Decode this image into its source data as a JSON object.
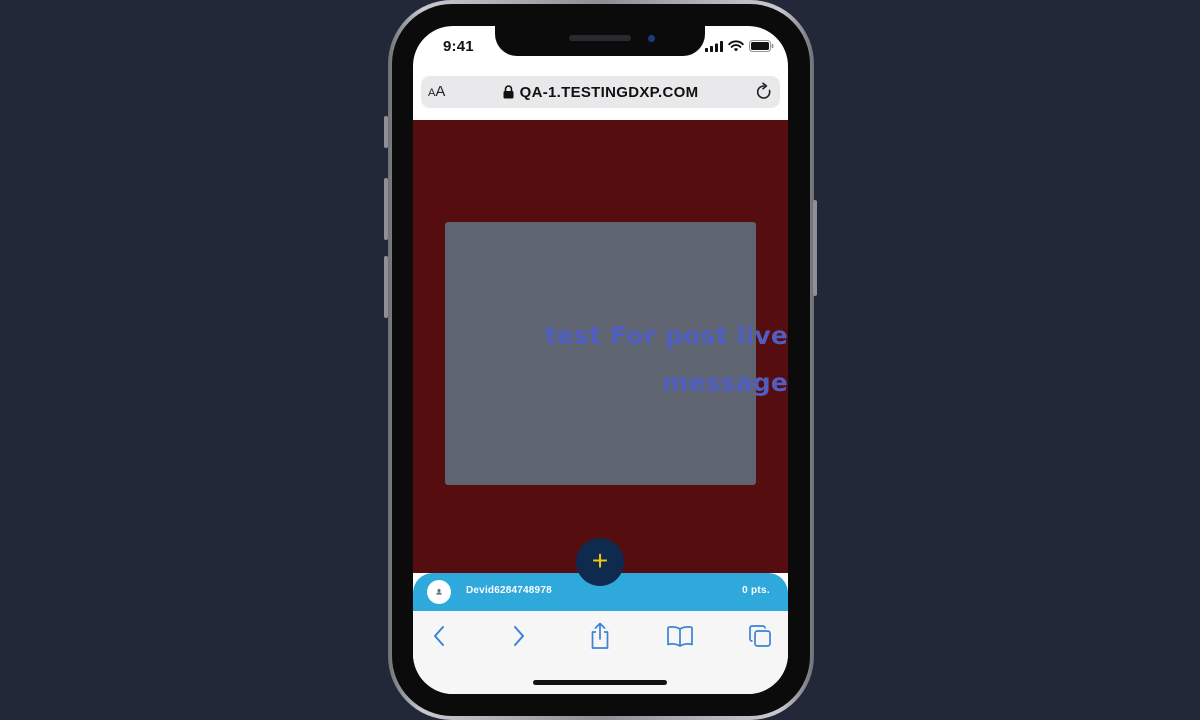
{
  "status_bar": {
    "time": "9:41",
    "icons": [
      "signal-icon",
      "wifi-icon",
      "battery-icon"
    ]
  },
  "browser": {
    "text_size_label_small": "A",
    "text_size_label_large": "A",
    "url": "QA-1.TESTINGDXP.COM",
    "icons": [
      "lock-icon",
      "reload-icon"
    ]
  },
  "page": {
    "card_message": "test For post live message",
    "fab_label": "+"
  },
  "user_bar": {
    "username": "Devid6284748978",
    "points": "0 pts."
  },
  "toolbar": {
    "icons": [
      "back-icon",
      "forward-icon",
      "share-icon",
      "bookmarks-icon",
      "tabs-icon"
    ]
  },
  "colors": {
    "page_background": "#222838",
    "content_background": "#550d0f",
    "card_background": "#5e6570",
    "card_text": "#4f5ec0",
    "user_bar": "#2fa8dc",
    "fab_background": "#0e2a4e",
    "fab_plus": "#f2c318",
    "toolbar_icon": "#3b82d6"
  }
}
